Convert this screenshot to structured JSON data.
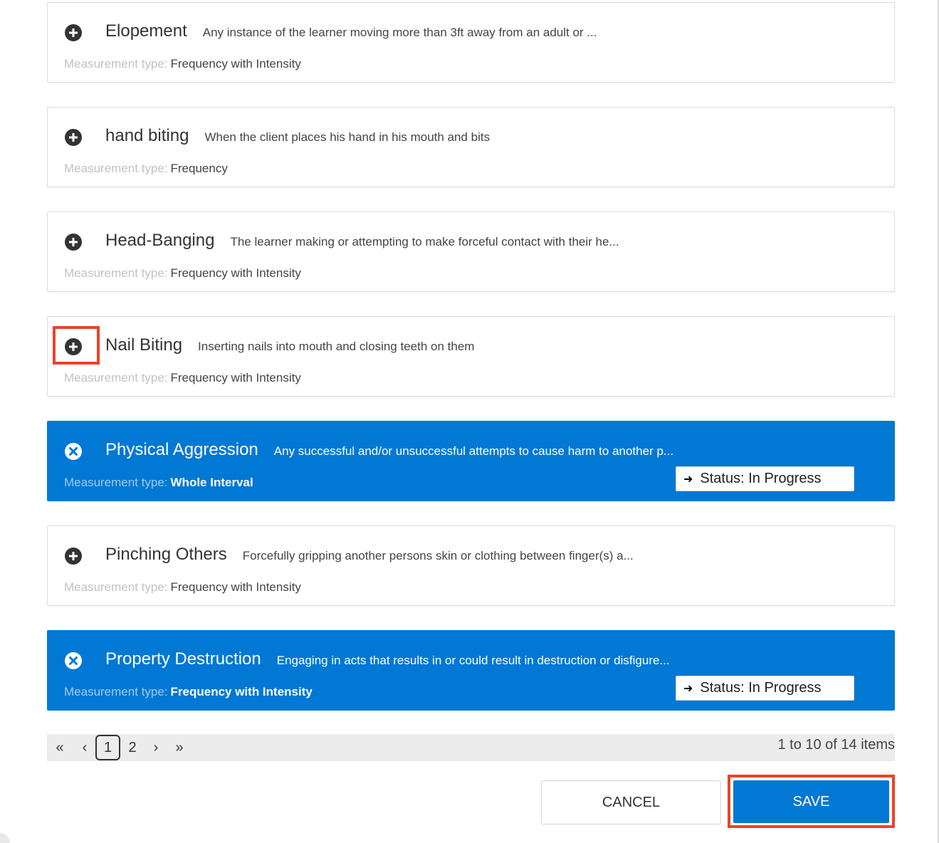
{
  "behaviors": [
    {
      "title": "Elopement",
      "description": "Any instance of the learner moving more than 3ft away from an adult or ...",
      "measurement_label": "Measurement type:",
      "measurement_value": "Frequency with Intensity",
      "selected": false
    },
    {
      "title": "hand biting",
      "description": "When the client places his hand in his mouth and bits",
      "measurement_label": "Measurement type:",
      "measurement_value": "Frequency",
      "selected": false
    },
    {
      "title": "Head-Banging",
      "description": "The learner making or attempting to make forceful contact with their he...",
      "measurement_label": "Measurement type:",
      "measurement_value": "Frequency with Intensity",
      "selected": false
    },
    {
      "title": "Nail Biting",
      "description": "Inserting nails into mouth and closing teeth on them",
      "measurement_label": "Measurement type:",
      "measurement_value": "Frequency with Intensity",
      "selected": false
    },
    {
      "title": "Physical Aggression",
      "description": "Any successful and/or unsuccessful attempts to cause harm to another p...",
      "measurement_label": "Measurement type:",
      "measurement_value": "Whole Interval",
      "selected": true,
      "status": "Status: In Progress"
    },
    {
      "title": "Pinching Others",
      "description": "Forcefully gripping another persons skin or clothing between finger(s) a...",
      "measurement_label": "Measurement type:",
      "measurement_value": "Frequency with Intensity",
      "selected": false
    },
    {
      "title": "Property Destruction",
      "description": "Engaging in acts that results in or could result in destruction or disfigure...",
      "measurement_label": "Measurement type:",
      "measurement_value": "Frequency with Intensity",
      "selected": true,
      "status": "Status: In Progress"
    }
  ],
  "icons": {
    "add": "plus-circle-icon",
    "remove": "x-circle-icon",
    "status": "arrow-right-icon"
  },
  "colors": {
    "accent": "#0078d4",
    "highlight": "#e8442a"
  },
  "pagination": {
    "first": "«",
    "prev": "‹",
    "pages": [
      "1",
      "2"
    ],
    "current": "1",
    "next": "›",
    "last": "»",
    "info": "1 to 10 of 14 items"
  },
  "actions": {
    "cancel": "CANCEL",
    "save": "SAVE"
  }
}
